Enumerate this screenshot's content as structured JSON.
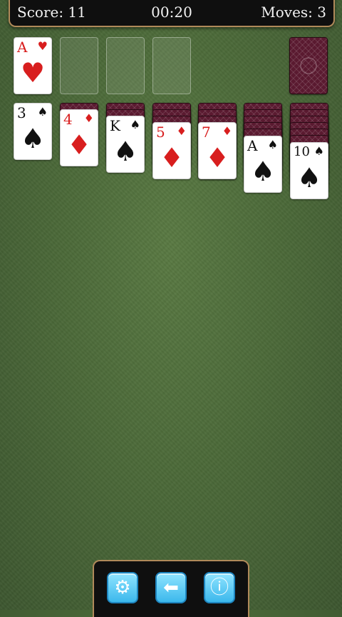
{
  "status": {
    "score_text": "Score: 11",
    "timer_text": "00:20",
    "moves_text": "Moves: 3"
  },
  "foundation": [
    {
      "rank": "A",
      "suit": "♥",
      "color": "#d81e1e"
    },
    null,
    null,
    null
  ],
  "stock": {
    "face": "down"
  },
  "tableau": [
    {
      "hidden": 0,
      "top": {
        "rank": "3",
        "suit": "♠"
      }
    },
    {
      "hidden": 1,
      "top": {
        "rank": "4",
        "suit": "♦"
      }
    },
    {
      "hidden": 2,
      "top": {
        "rank": "K",
        "suit": "♠"
      }
    },
    {
      "hidden": 3,
      "top": {
        "rank": "5",
        "suit": "♦"
      }
    },
    {
      "hidden": 4,
      "top": {
        "rank": "7",
        "suit": "♦"
      }
    },
    {
      "hidden": 5,
      "top": {
        "rank": "A",
        "suit": "♠"
      }
    },
    {
      "hidden": 6,
      "top": {
        "rank": "10",
        "suit": "♠"
      }
    }
  ],
  "toolbar": {
    "settings_icon": "⚙",
    "undo_icon": "⬅",
    "info_icon": "ⓘ"
  },
  "colors": {
    "felt": "#4c6a39",
    "accent": "#b08a5a",
    "button": "#3cb8ec",
    "card_back": "#5a1a30"
  }
}
